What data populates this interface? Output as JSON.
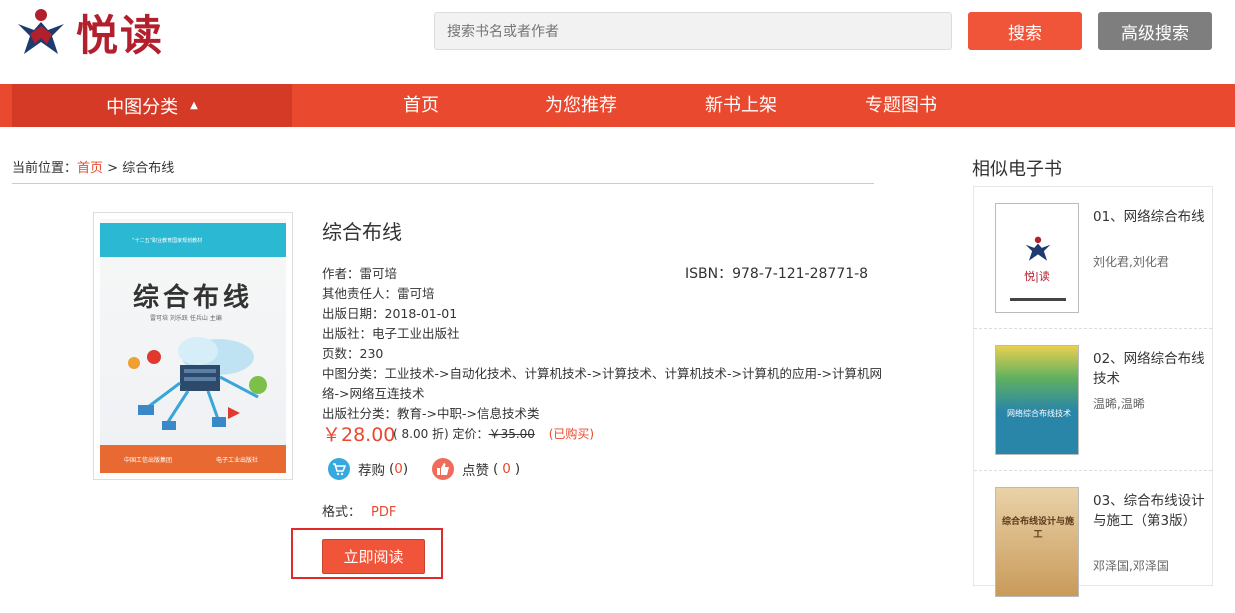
{
  "header": {
    "logo_text": "悦读",
    "search_placeholder": "搜索书名或者作者",
    "search_button": "搜索",
    "advanced_button": "高级搜索"
  },
  "nav": {
    "category": "中图分类",
    "items": [
      "首页",
      "为您推荐",
      "新书上架",
      "专题图书"
    ]
  },
  "breadcrumb": {
    "prefix": "当前位置：",
    "home": "首页",
    "sep": " > ",
    "current": "综合布线"
  },
  "book": {
    "title": "综合布线",
    "cover": {
      "series": "“十二五”职业教育国家规划教材",
      "title": "综合布线",
      "authors": "雷可培 刘乐跃 任兵山 主编",
      "publisher_left": "中国工信出版集团",
      "publisher_right": "电子工业出版社"
    },
    "author": "作者：雷可培",
    "other": "其他责任人：雷可培",
    "date": "出版日期：2018-01-01",
    "publisher": "出版社：电子工业出版社",
    "pages": "页数：230",
    "clc_line1": "中图分类：工业技术->自动化技术、计算机技术->计算技术、计算机技术->计算机的应用->计算机网",
    "clc_line2": "络->网络互连技术",
    "pub_cat": "出版社分类：教育->中职->信息技术类",
    "isbn": "ISBN：978-7-121-28771-8",
    "price": "￥28.00",
    "discount": "( 8.00 折)",
    "list_label": "定价：",
    "list_price": "￥35.00",
    "bought": "(已购买)",
    "cart_label": "荐购",
    "cart_count": "0",
    "like_label": "点赞",
    "like_count": "0",
    "paren_open": "(",
    "paren_close": ")",
    "format_label": "格式：",
    "format_value": "PDF",
    "read_button": "立即阅读"
  },
  "similar": {
    "title": "相似电子书",
    "items": [
      {
        "title": "01、网络综合布线",
        "author": "刘化君,刘化君",
        "cover_text": "悦|读"
      },
      {
        "title": "02、网络综合布线技术",
        "author": "温晞,温晞",
        "cover_text": "网络综合布线技术"
      },
      {
        "title": "03、综合布线设计与施工（第3版）",
        "author": "邓泽国,邓泽国",
        "cover_text": "综合布线设计与施工"
      }
    ]
  },
  "colors": {
    "accent": "#e9492f",
    "nav_dark": "#d53a27",
    "logo": "#b21f2d"
  }
}
